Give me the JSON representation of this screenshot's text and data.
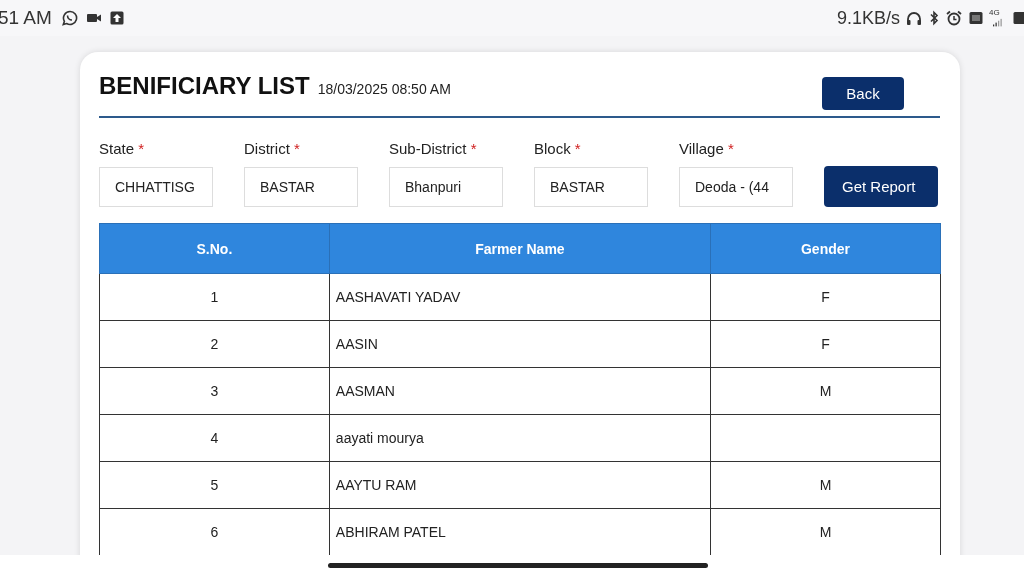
{
  "status_bar": {
    "time": "51 AM",
    "speed": "9.1KB/s",
    "network": "4G"
  },
  "header": {
    "title": "BENIFICIARY LIST",
    "timestamp": "18/03/2025 08:50 AM",
    "back_button": "Back"
  },
  "filters": [
    {
      "label": "State",
      "required_mark": "*",
      "value": "CHHATTISG"
    },
    {
      "label": "District",
      "required_mark": "*",
      "value": "BASTAR"
    },
    {
      "label": "Sub-District",
      "required_mark": "*",
      "value": "Bhanpuri"
    },
    {
      "label": "Block",
      "required_mark": "*",
      "value": "BASTAR"
    },
    {
      "label": "Village",
      "required_mark": "*",
      "value": "Deoda - (44"
    }
  ],
  "report_button": "Get Report",
  "table": {
    "columns": [
      "S.No.",
      "Farmer Name",
      "Gender"
    ],
    "rows": [
      [
        "1",
        "AASHAVATI YADAV",
        "F"
      ],
      [
        "2",
        "AASIN",
        "F"
      ],
      [
        "3",
        "AASMAN",
        "M"
      ],
      [
        "4",
        "aayati mourya",
        ""
      ],
      [
        "5",
        "AAYTU RAM",
        "M"
      ],
      [
        "6",
        "ABHIRAM PATEL",
        "M"
      ]
    ]
  }
}
